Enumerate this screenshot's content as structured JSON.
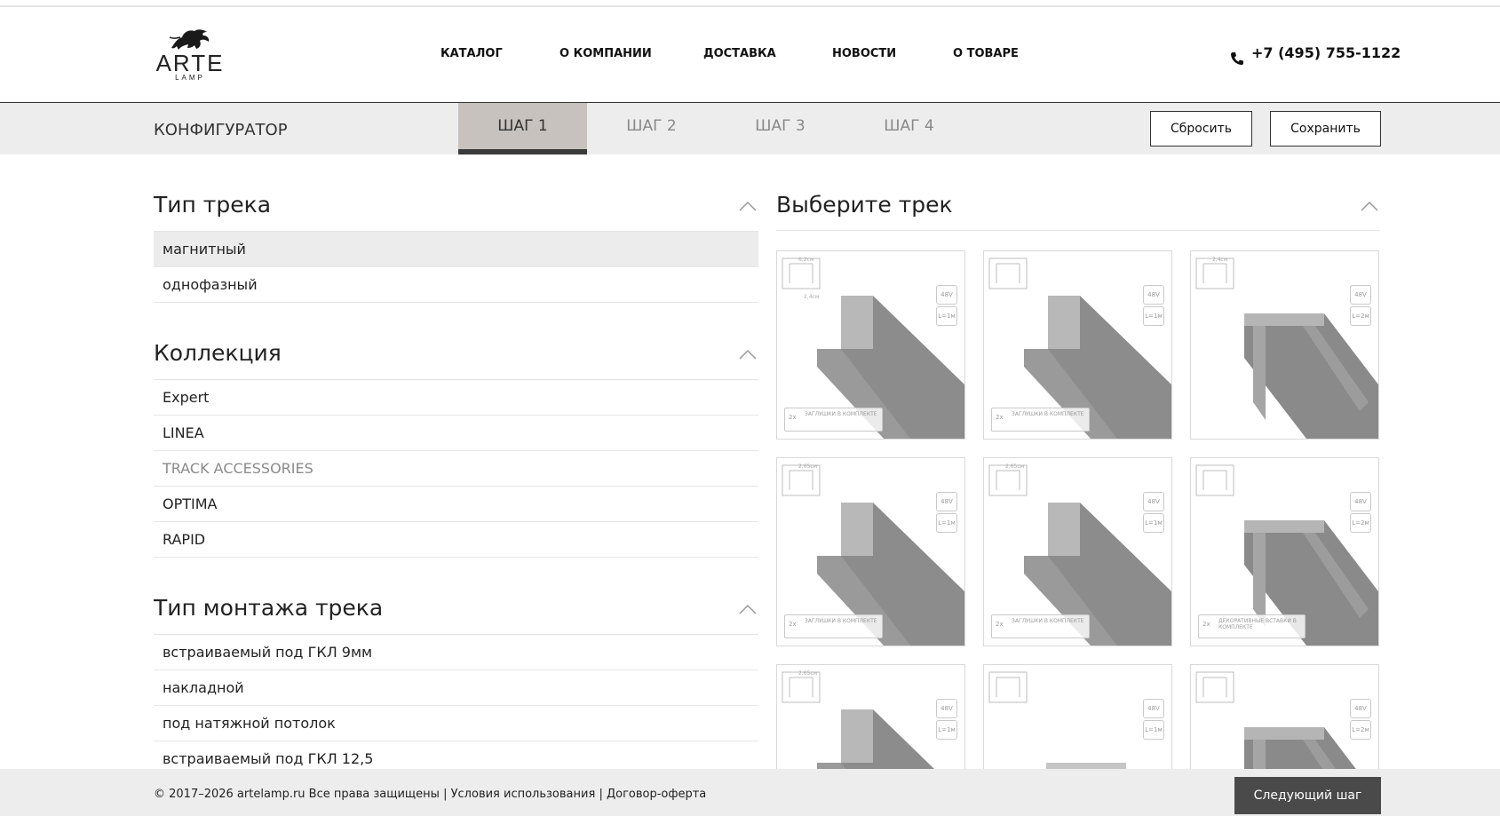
{
  "header": {
    "logo": {
      "word": "ARTE",
      "sub": "LAMP",
      "icon": "lion-icon"
    },
    "nav": [
      "КАТАЛОГ",
      "О КОМПАНИИ",
      "ДОСТАВКА",
      "НОВОСТИ",
      "О ТОВАРЕ"
    ],
    "phone": "+7 (495) 755-1122",
    "phone_icon": "phone-icon"
  },
  "configurator": {
    "title": "КОНФИГУРАТОР",
    "steps": [
      "ШАГ 1",
      "ШАГ 2",
      "ШАГ 3",
      "ШАГ 4"
    ],
    "active_step": "ШАГ 1",
    "reset_label": "Сбросить",
    "save_label": "Сохранить"
  },
  "filters": {
    "track_type": {
      "title": "Тип трека",
      "options": [
        "магнитный",
        "однофазный"
      ],
      "selected": "магнитный"
    },
    "collection": {
      "title": "Коллекция",
      "options": [
        "Expert",
        "LINEA",
        "TRACK ACCESSORIES",
        "OPTIMA",
        "RAPID"
      ],
      "disabled": "TRACK ACCESSORIES"
    },
    "mount_type": {
      "title": "Тип монтажа трека",
      "options": [
        "встраиваемый под ГКЛ 9мм",
        "накладной",
        "под натяжной потолок",
        "встраиваемый под ГКЛ 12,5"
      ]
    }
  },
  "tracks": {
    "title": "Выберите трек",
    "items": [
      {
        "badges": [
          "48V",
          "L=1м"
        ],
        "note": "ЗАГЛУШКИ В КОМПЛЕКТЕ",
        "dims": [
          "6,2см",
          "2,4см"
        ]
      },
      {
        "badges": [
          "48V",
          "L=1м"
        ],
        "note": "ЗАГЛУШКИ В КОМПЛЕКТЕ",
        "dims": []
      },
      {
        "badges": [
          "48V",
          "L=2м"
        ],
        "note": "",
        "dims": [
          "2,4см"
        ]
      },
      {
        "badges": [
          "48V",
          "L=1м"
        ],
        "note": "ЗАГЛУШКИ В КОМПЛЕКТЕ",
        "dims": [
          "2,65см"
        ]
      },
      {
        "badges": [
          "48V",
          "L=1м"
        ],
        "note": "ЗАГЛУШКИ В КОМПЛЕКТЕ",
        "dims": [
          "2,65см"
        ]
      },
      {
        "badges": [
          "48V",
          "L=2м"
        ],
        "note": "ДЕКОРАТИВНЫЕ ВСТАВКИ В КОМПЛЕКТЕ",
        "dims": []
      },
      {
        "badges": [
          "48V",
          "L=1м"
        ],
        "note": "",
        "dims": [
          "2,65см"
        ]
      },
      {
        "badges": [
          "48V",
          "L=1м"
        ],
        "note": "",
        "dims": []
      },
      {
        "badges": [
          "48V",
          "L=2м"
        ],
        "note": "",
        "dims": []
      }
    ]
  },
  "footer": {
    "copyright": "© 2017–2026 artelamp.ru Все права защищены",
    "sep": "|",
    "terms": "Условия использования",
    "offer": "Договор-оферта",
    "next_label": "Следующий шаг"
  }
}
